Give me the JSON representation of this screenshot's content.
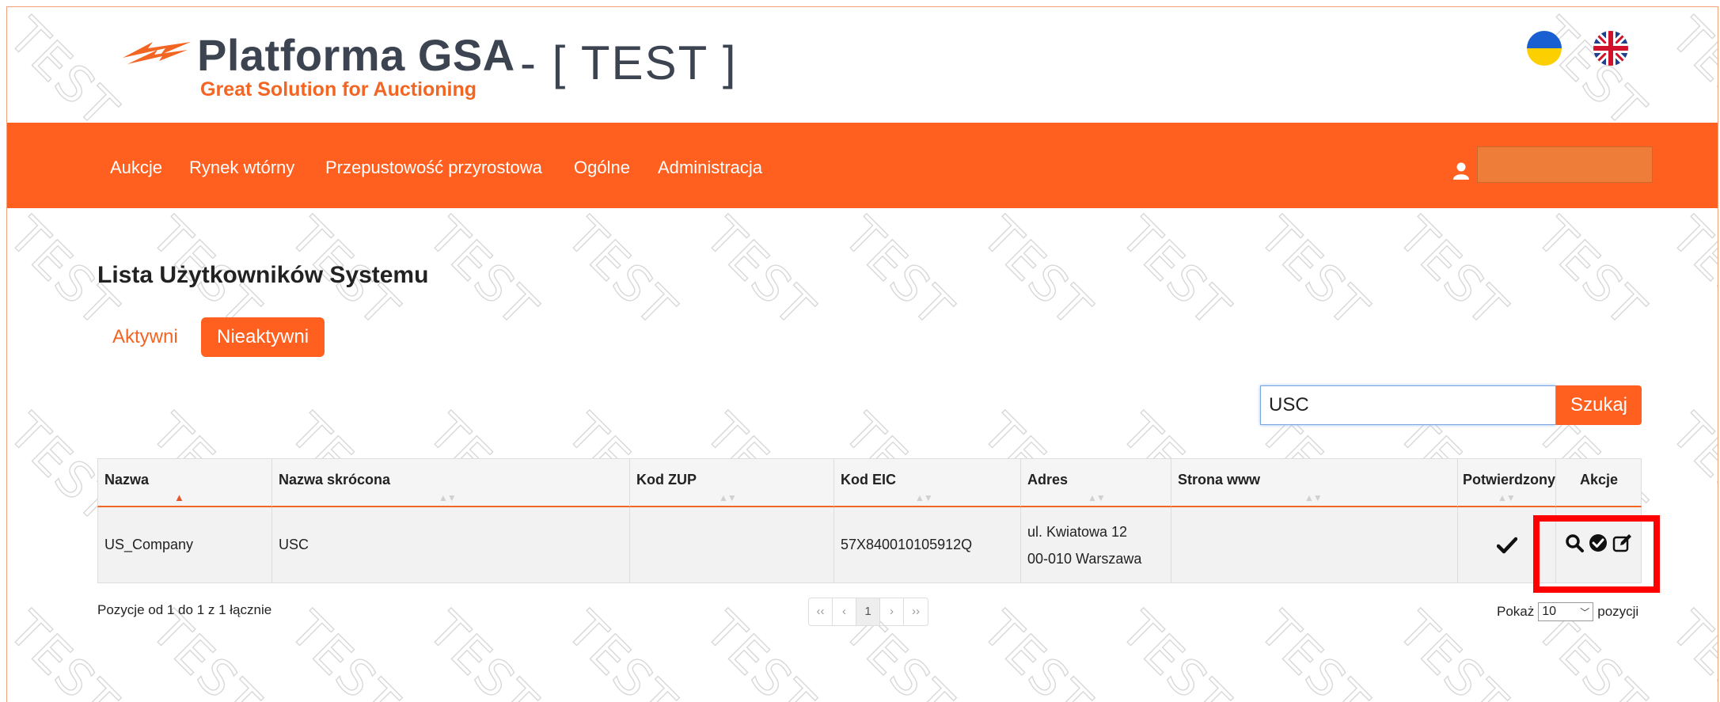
{
  "header": {
    "logo_title": "Platforma GSA",
    "logo_subtitle": "Great Solution for Auctioning",
    "env_label": "- [ TEST ]",
    "flags": [
      "ukraine-flag-icon",
      "uk-flag-icon"
    ]
  },
  "watermark": "TEST",
  "nav": {
    "items": [
      "Aukcje",
      "Rynek wtórny",
      "Przepustowość przyrostowa",
      "Ogólne",
      "Administracja"
    ],
    "user_icon": "user-icon"
  },
  "page": {
    "title": "Lista Użytkowników Systemu",
    "tabs": [
      "Aktywni",
      "Nieaktywni"
    ],
    "active_tab": "Nieaktywni"
  },
  "search": {
    "value": "USC",
    "button": "Szukaj"
  },
  "table": {
    "columns": [
      "Nazwa",
      "Nazwa skrócona",
      "Kod ZUP",
      "Kod EIC",
      "Adres",
      "Strona www",
      "Potwierdzony",
      "Akcje"
    ],
    "sorted_column": "Nazwa",
    "rows": [
      {
        "nazwa": "US_Company",
        "nazwa_skrocona": "USC",
        "kod_zup": "",
        "kod_eic": "57X840010105912Q",
        "adres_line1": "ul. Kwiatowa 12",
        "adres_line2": "00-010 Warszawa",
        "strona_www": "",
        "potwierdzony": true,
        "actions": [
          "search-icon",
          "check-circle-icon",
          "edit-icon"
        ]
      }
    ]
  },
  "footer": {
    "info": "Pozycje od 1 do 1 z 1 łącznie",
    "pager": [
      "‹‹",
      "‹",
      "1",
      "›",
      "››"
    ],
    "current_page": "1",
    "show_label": "Pokaż",
    "page_size": "10",
    "items_label": "pozycji"
  },
  "colors": {
    "brand_orange": "#ff5f1f",
    "text_dark": "#3d4451",
    "highlight_red": "#ff0000"
  }
}
